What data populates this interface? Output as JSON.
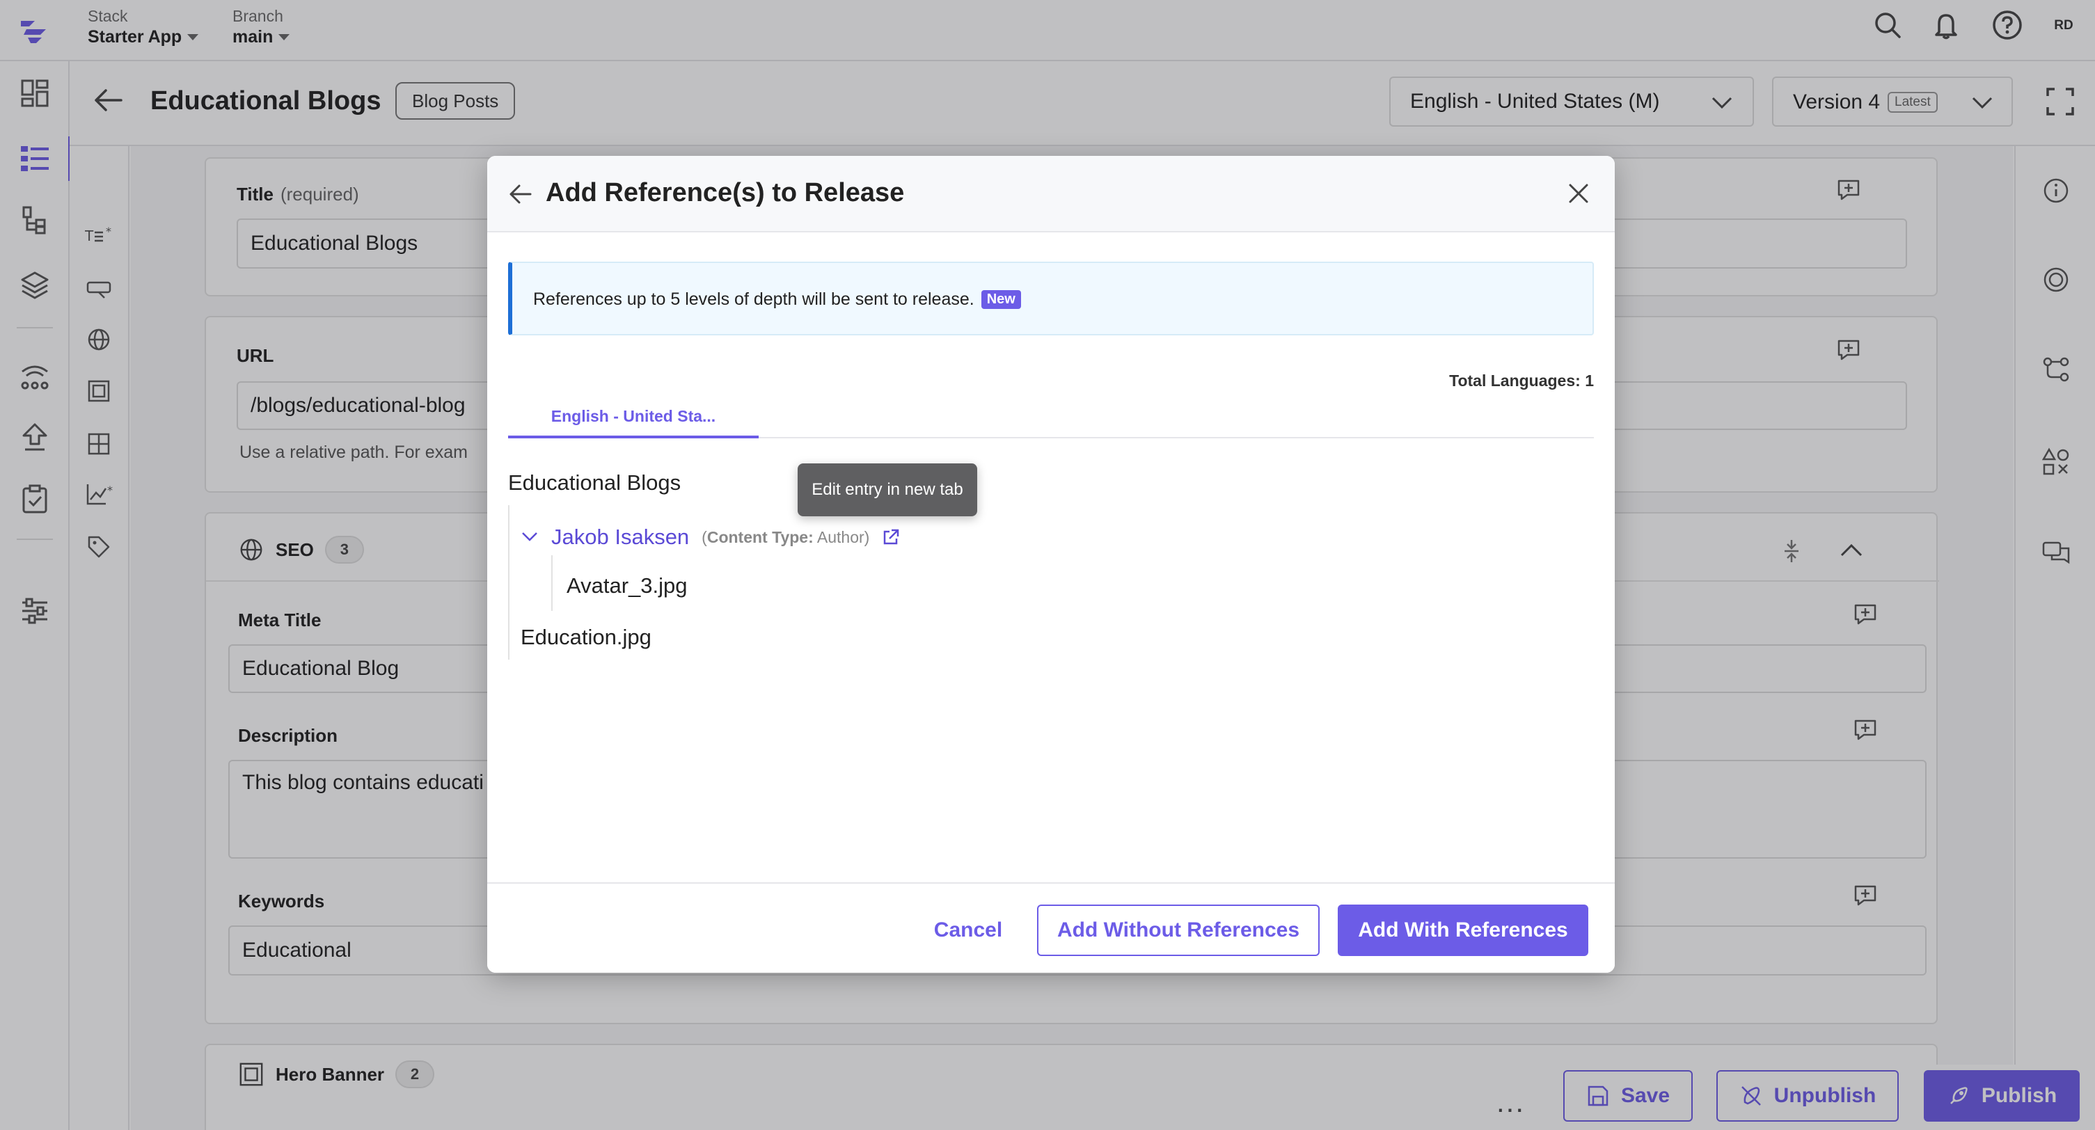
{
  "topbar": {
    "stack_label": "Stack",
    "stack_value": "Starter App",
    "branch_label": "Branch",
    "branch_value": "main",
    "avatar_initials": "RD",
    "icons": [
      "search-icon",
      "bell-icon",
      "help-icon"
    ]
  },
  "entry": {
    "title": "Educational Blogs",
    "content_type_badge": "Blog Posts",
    "language": "English - United States (M)",
    "version": "Version 4",
    "version_badge": "Latest"
  },
  "form": {
    "title": {
      "label": "Title",
      "required": "(required)",
      "value": "Educational Blogs"
    },
    "url": {
      "label": "URL",
      "value": "/blogs/educational-blog",
      "help": "Use a relative path. For exam"
    },
    "seo": {
      "label": "SEO",
      "count": "3",
      "meta_title": {
        "label": "Meta Title",
        "value": "Educational Blog"
      },
      "description": {
        "label": "Description",
        "value": "This blog contains educati"
      },
      "keywords": {
        "label": "Keywords",
        "value": "Educational"
      }
    },
    "hero_banner": {
      "label": "Hero Banner",
      "count": "2"
    }
  },
  "bottom_bar": {
    "more": "...",
    "save": "Save",
    "unpublish": "Unpublish",
    "publish": "Publish"
  },
  "modal": {
    "title": "Add Reference(s) to Release",
    "info": "References up to 5 levels of depth will be sent to release.",
    "info_badge": "New",
    "total_languages": "Total Languages: 1",
    "tab": "English - United Sta...",
    "tree": {
      "root": "Educational Blogs",
      "entry": "Jakob Isaksen",
      "entry_ct_label": "Content Type:",
      "entry_ct_value": "Author",
      "child_asset": "Avatar_3.jpg",
      "asset": "Education.jpg"
    },
    "tooltip": "Edit entry in new tab",
    "buttons": {
      "cancel": "Cancel",
      "without": "Add Without References",
      "with": "Add With References"
    }
  },
  "colors": {
    "accent": "#6c5ce7",
    "info_border": "#1d6fd6",
    "tooltip_bg": "#5f5f61"
  }
}
